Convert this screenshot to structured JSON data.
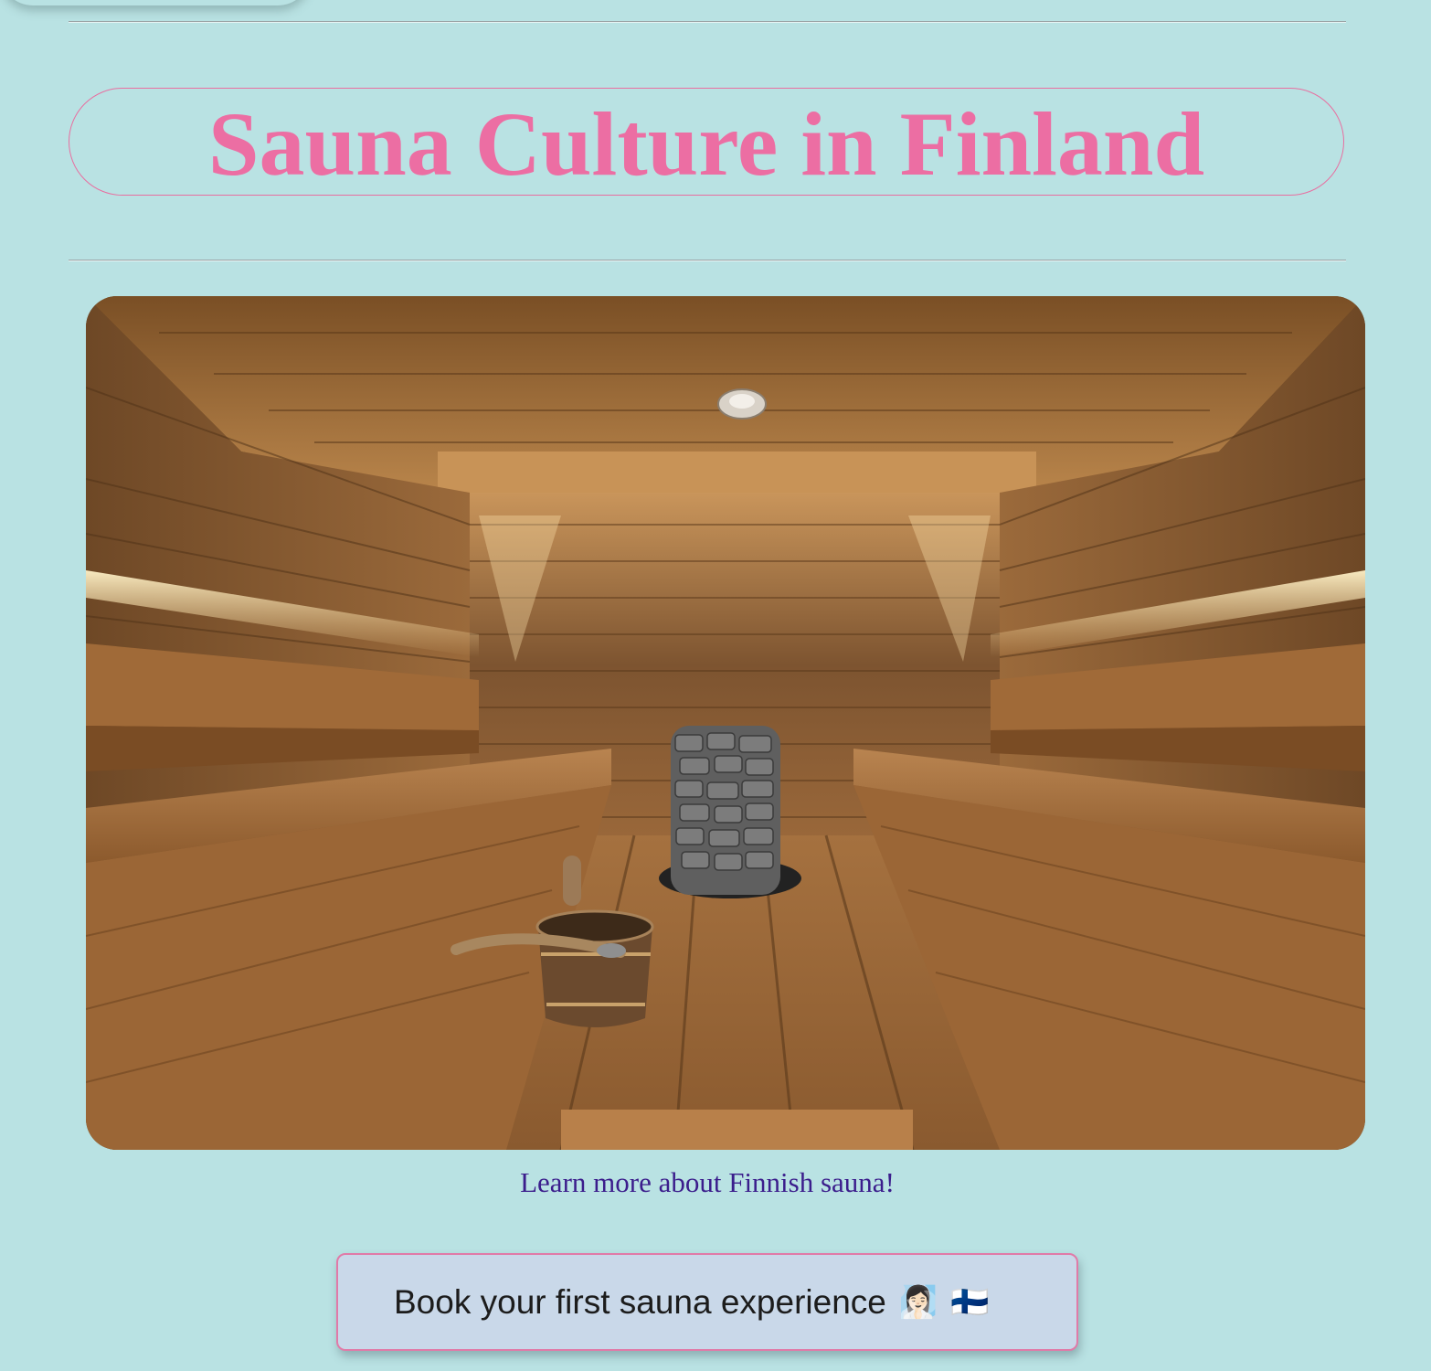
{
  "page": {
    "title": "Sauna Culture in Finland",
    "link_text": "Learn more about Finnish sauna!",
    "button_label": "Book your first sauna experience",
    "button_icons": [
      "sauna-person-emoji",
      "finland-flag-emoji"
    ]
  },
  "photo": {
    "subject": "finnish-sauna-interior-photo"
  },
  "colors": {
    "background": "#b9e2e3",
    "title": "#ec6ea3",
    "title_border": "#e86fa0",
    "link": "#3b1d8c",
    "button_bg": "#c9d8e9",
    "button_border": "#e17aa8"
  }
}
